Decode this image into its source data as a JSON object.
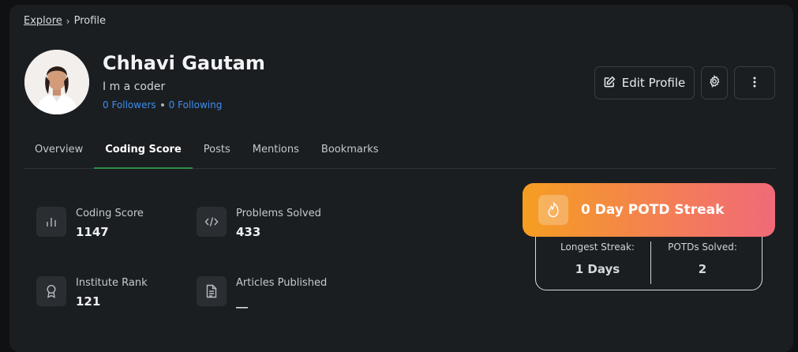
{
  "breadcrumb": {
    "explore": "Explore",
    "separator": "›",
    "current": "Profile"
  },
  "profile": {
    "name": "Chhavi Gautam",
    "bio": "I m a coder",
    "followers": "0 Followers",
    "following": "0 Following"
  },
  "actions": {
    "edit_label": "Edit Profile",
    "edit_icon": "edit-icon",
    "settings_icon": "gear-icon",
    "more_icon": "more-vertical-icon"
  },
  "tabs": [
    {
      "label": "Overview",
      "active": false
    },
    {
      "label": "Coding Score",
      "active": true
    },
    {
      "label": "Posts",
      "active": false
    },
    {
      "label": "Mentions",
      "active": false
    },
    {
      "label": "Bookmarks",
      "active": false
    }
  ],
  "stats": {
    "coding_score": {
      "label": "Coding Score",
      "value": "1147",
      "icon": "bar-chart-icon"
    },
    "problems_solved": {
      "label": "Problems Solved",
      "value": "433",
      "icon": "code-icon"
    },
    "institute_rank": {
      "label": "Institute Rank",
      "value": "121",
      "icon": "award-icon"
    },
    "articles_published": {
      "label": "Articles Published",
      "value": "__",
      "icon": "document-icon"
    }
  },
  "streak": {
    "title": "0 Day POTD Streak",
    "icon": "fire-icon",
    "longest_label": "Longest Streak:",
    "longest_value": "1 Days",
    "solved_label": "POTDs Solved:",
    "solved_value": "2"
  },
  "colors": {
    "accent_green": "#2f8d46",
    "link_blue": "#3d8ef0",
    "streak_start": "#f59e21",
    "streak_end": "#f06a78"
  }
}
